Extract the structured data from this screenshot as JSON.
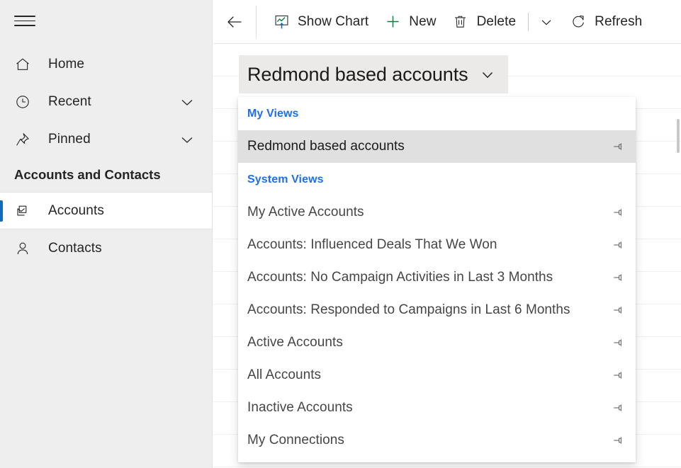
{
  "sidebar": {
    "menu_icon": "hamburger-icon",
    "items": [
      {
        "label": "Home",
        "icon": "home-icon",
        "expandable": false,
        "selected": false
      },
      {
        "label": "Recent",
        "icon": "clock-icon",
        "expandable": true,
        "selected": false
      },
      {
        "label": "Pinned",
        "icon": "pin-icon",
        "expandable": true,
        "selected": false
      }
    ],
    "section_title": "Accounts and Contacts",
    "entity_items": [
      {
        "label": "Accounts",
        "icon": "accounts-icon",
        "selected": true
      },
      {
        "label": "Contacts",
        "icon": "contact-person-icon",
        "selected": false
      }
    ],
    "selection_accent": "#0f6cbd",
    "background": "#eeeeee"
  },
  "toolbar": {
    "back_icon": "back-arrow-icon",
    "buttons": [
      {
        "label": "Show Chart",
        "icon": "show-chart-icon"
      },
      {
        "label": "New",
        "icon": "plus-icon"
      },
      {
        "label": "Delete",
        "icon": "trash-icon"
      }
    ],
    "overflow_icon": "chevron-down-icon",
    "refresh": {
      "label": "Refresh",
      "icon": "refresh-icon"
    },
    "new_accent": "#107c41"
  },
  "view_selector": {
    "current_view": "Redmond based accounts",
    "caret_icon": "chevron-down-icon",
    "expanded": true,
    "background": "#ebeae9"
  },
  "flyout": {
    "groups": [
      {
        "header": "My Views",
        "header_color": "#1f6feb",
        "items": [
          {
            "label": "Redmond based accounts",
            "pin_icon": "unpin-icon",
            "current": true
          }
        ]
      },
      {
        "header": "System Views",
        "header_color": "#1f6feb",
        "items": [
          {
            "label": "My Active Accounts",
            "pin_icon": "unpin-icon",
            "current": false
          },
          {
            "label": "Accounts: Influenced Deals That We Won",
            "pin_icon": "unpin-icon",
            "current": false
          },
          {
            "label": "Accounts: No Campaign Activities in Last 3 Months",
            "pin_icon": "unpin-icon",
            "current": false
          },
          {
            "label": "Accounts: Responded to Campaigns in Last 6 Months",
            "pin_icon": "unpin-icon",
            "current": false
          },
          {
            "label": "Active Accounts",
            "pin_icon": "unpin-icon",
            "current": false
          },
          {
            "label": "All Accounts",
            "pin_icon": "unpin-icon",
            "current": false
          },
          {
            "label": "Inactive Accounts",
            "pin_icon": "unpin-icon",
            "current": false
          },
          {
            "label": "My Connections",
            "pin_icon": "unpin-icon",
            "current": false
          }
        ]
      }
    ]
  },
  "grid": {
    "row_count": 13,
    "scrollbar_visible": true
  }
}
